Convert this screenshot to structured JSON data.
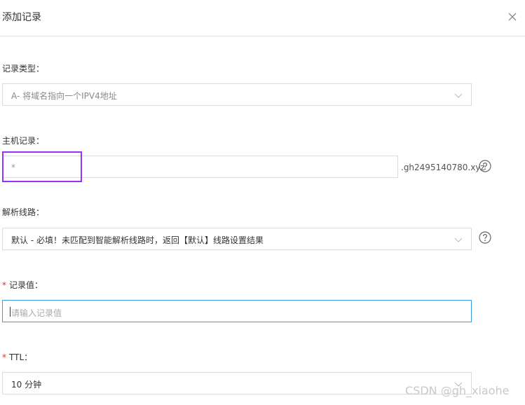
{
  "dialog": {
    "title": "添加记录"
  },
  "record_type": {
    "label": "记录类型：",
    "selected": "A- 将域名指向一个IPV4地址"
  },
  "host": {
    "label": "主机记录：",
    "value": "*",
    "suffix": ".gh2495140780.xyz"
  },
  "resolution_line": {
    "label": "解析线路：",
    "selected": "默认 - 必填！未匹配到智能解析线路时，返回【默认】线路设置结果"
  },
  "record_value": {
    "required_mark": "*",
    "label": "记录值：",
    "placeholder": "请输入记录值"
  },
  "ttl": {
    "required_mark": "*",
    "label": "TTL：",
    "selected": "10 分钟"
  },
  "watermark": "CSDN @gh_xiaohe",
  "colors": {
    "focus_border": "#3b9ce6",
    "required": "#d9312f",
    "highlight": "#9b30ff"
  },
  "icons": [
    "close-icon",
    "chevron-down-icon",
    "help-circle-icon"
  ]
}
